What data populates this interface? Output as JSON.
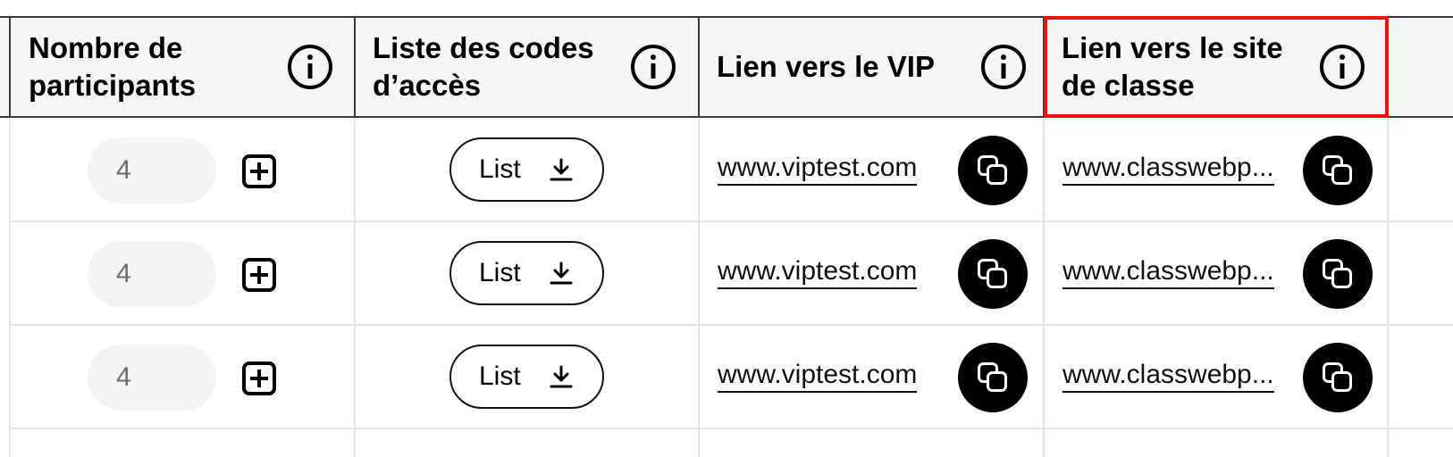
{
  "headers": {
    "participants": "Nombre de\nparticipants",
    "codes": "Liste des codes\nd’accès",
    "vip": "Lien vers le VIP",
    "class_site": "Lien vers le site\nde classe"
  },
  "icons": {
    "info": "info-circle-icon",
    "plus": "plus-square-icon",
    "download": "download-icon",
    "copy": "copy-icon"
  },
  "colors": {
    "highlight": "#ee1111",
    "header_bg": "#f5f5f5",
    "pill_bg": "#f3f3f3"
  },
  "rows": [
    {
      "participants": "4",
      "list_label": "List",
      "vip_link": "www.viptest.com",
      "class_link": "www.classwebp..."
    },
    {
      "participants": "4",
      "list_label": "List",
      "vip_link": "www.viptest.com",
      "class_link": "www.classwebp..."
    },
    {
      "participants": "4",
      "list_label": "List",
      "vip_link": "www.viptest.com",
      "class_link": "www.classwebp..."
    }
  ]
}
